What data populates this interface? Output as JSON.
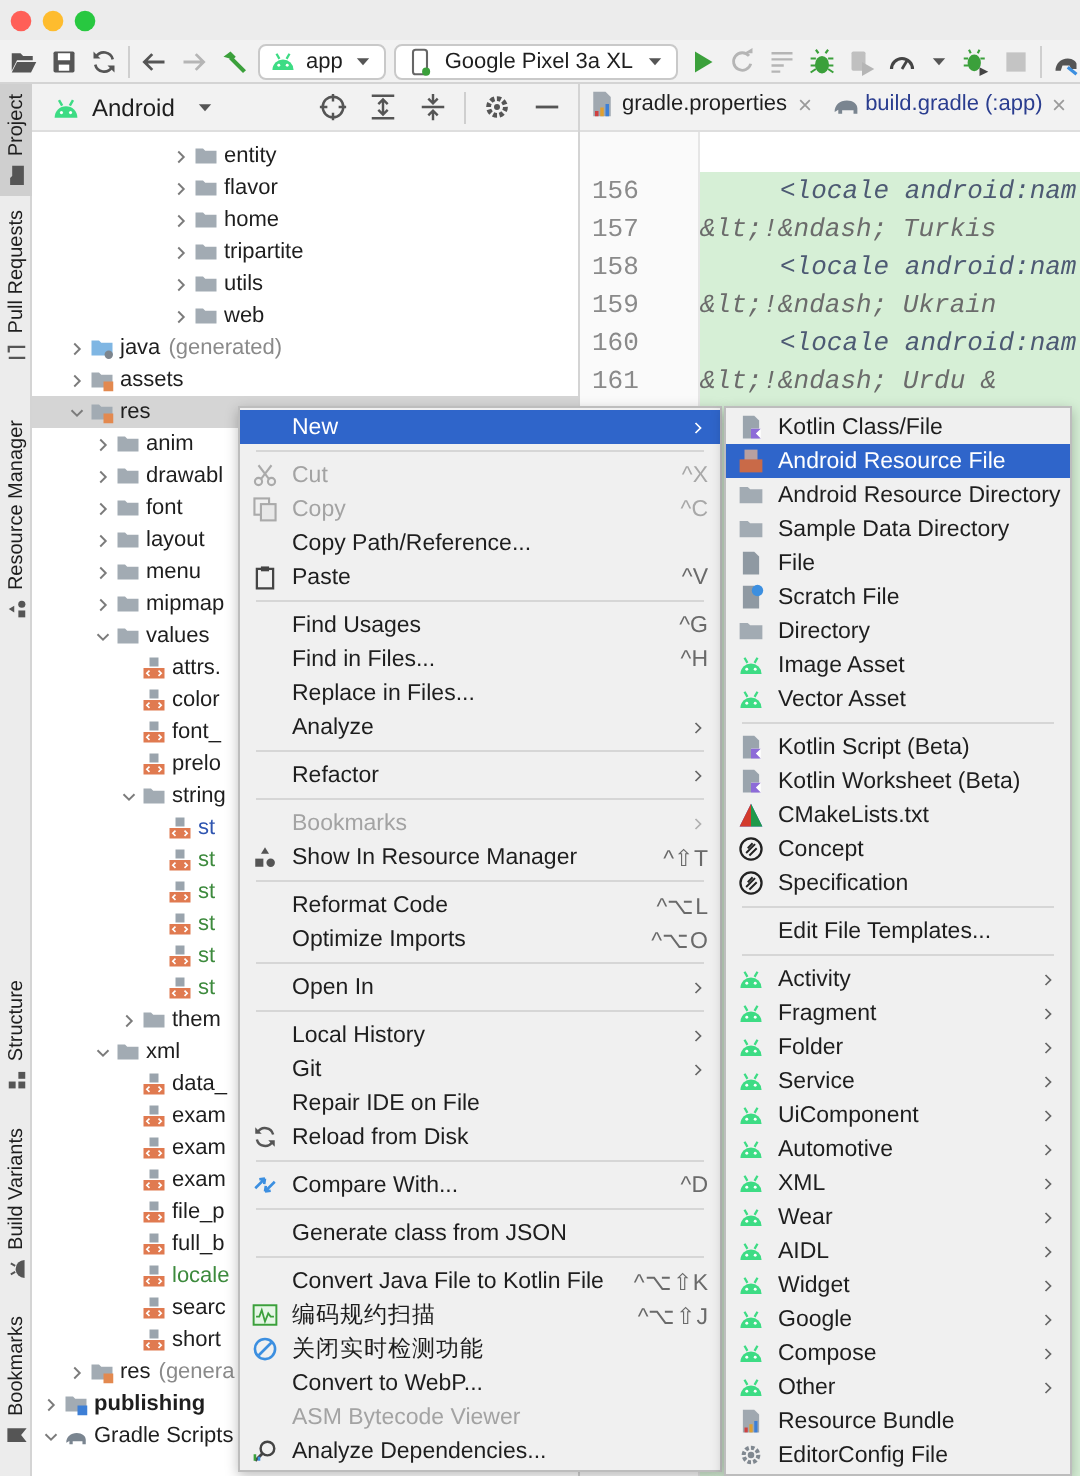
{
  "toolbar": {
    "module": "app",
    "device": "Google Pixel 3a XL"
  },
  "side_tabs": [
    {
      "label": "Project",
      "selected": true
    },
    {
      "label": "Pull Requests",
      "selected": false
    },
    {
      "label": "Resource Manager",
      "selected": false
    },
    {
      "label": "Structure",
      "selected": false
    },
    {
      "label": "Build Variants",
      "selected": false
    },
    {
      "label": "Bookmarks",
      "selected": false
    }
  ],
  "project_panel": {
    "view": "Android",
    "tree": [
      {
        "children": [
          {
            "children": [
              {
                "children": [
                  {
                    "children": [
                      {
                        "children": [
                          {
                            "label": "entity",
                            "kind": "folder",
                            "expanded": false,
                            "selected": false,
                            "color": "#1e1e1e"
                          },
                          {
                            "label": "flavor",
                            "kind": "folder",
                            "expanded": false,
                            "selected": false,
                            "color": "#1e1e1e"
                          },
                          {
                            "label": "home",
                            "kind": "folder",
                            "expanded": false,
                            "selected": false,
                            "color": "#1e1e1e"
                          },
                          {
                            "label": "tripartite",
                            "kind": "folder",
                            "expanded": false,
                            "selected": false,
                            "color": "#1e1e1e"
                          },
                          {
                            "label": "utils",
                            "kind": "folder",
                            "expanded": false,
                            "selected": false,
                            "color": "#1e1e1e"
                          },
                          {
                            "label": "web",
                            "kind": "folder",
                            "expanded": false,
                            "selected": false,
                            "color": "#1e1e1e"
                          }
                        ]
                      }
                    ]
                  }
                ]
              }
            ]
          },
          {
            "label": "java",
            "note": "(generated)",
            "kind": "generated",
            "expanded": false,
            "selected": false,
            "color": "#1e1e1e"
          },
          {
            "label": "assets",
            "kind": "resources",
            "expanded": false,
            "selected": false,
            "color": "#1e1e1e"
          },
          {
            "label": "res",
            "kind": "resources",
            "expanded": true,
            "selected": true,
            "color": "#1e1e1e",
            "children": [
              {
                "label": "anim",
                "kind": "folder",
                "expanded": false,
                "selected": false,
                "color": "#1e1e1e"
              },
              {
                "label": "drawabl",
                "kind": "folder",
                "expanded": false,
                "selected": false,
                "color": "#1e1e1e"
              },
              {
                "label": "font",
                "kind": "folder",
                "expanded": false,
                "selected": false,
                "color": "#1e1e1e"
              },
              {
                "label": "layout",
                "kind": "folder",
                "expanded": false,
                "selected": false,
                "color": "#1e1e1e"
              },
              {
                "label": "menu",
                "kind": "folder",
                "expanded": false,
                "selected": false,
                "color": "#1e1e1e"
              },
              {
                "label": "mipmap",
                "kind": "folder",
                "expanded": false,
                "selected": false,
                "color": "#1e1e1e"
              },
              {
                "label": "values",
                "kind": "folder",
                "expanded": true,
                "selected": false,
                "color": "#1e1e1e",
                "children": [
                  {
                    "label": "attrs.",
                    "kind": "xml",
                    "selected": false,
                    "color": "#1e1e1e"
                  },
                  {
                    "label": "color",
                    "kind": "xml",
                    "selected": false,
                    "color": "#1e1e1e"
                  },
                  {
                    "label": "font_",
                    "kind": "xml",
                    "selected": false,
                    "color": "#1e1e1e"
                  },
                  {
                    "label": "prelo",
                    "kind": "xml",
                    "selected": false,
                    "color": "#1e1e1e"
                  },
                  {
                    "label": "string",
                    "kind": "folder",
                    "expanded": true,
                    "selected": false,
                    "color": "#1e1e1e",
                    "children": [
                      {
                        "label": "st",
                        "kind": "xml",
                        "selected": false,
                        "color": "#2f55b0"
                      },
                      {
                        "label": "st",
                        "kind": "xml",
                        "selected": false,
                        "color": "#3d8a3d"
                      },
                      {
                        "label": "st",
                        "kind": "xml",
                        "selected": false,
                        "color": "#3d8a3d"
                      },
                      {
                        "label": "st",
                        "kind": "xml",
                        "selected": false,
                        "color": "#3d8a3d"
                      },
                      {
                        "label": "st",
                        "kind": "xml",
                        "selected": false,
                        "color": "#3d8a3d"
                      },
                      {
                        "label": "st",
                        "kind": "xml",
                        "selected": false,
                        "color": "#3d8a3d"
                      }
                    ]
                  },
                  {
                    "label": "them",
                    "kind": "folder",
                    "expanded": false,
                    "selected": false,
                    "color": "#1e1e1e"
                  }
                ]
              },
              {
                "label": "xml",
                "kind": "folder",
                "expanded": true,
                "selected": false,
                "color": "#1e1e1e",
                "children": [
                  {
                    "label": "data_",
                    "kind": "xml",
                    "selected": false,
                    "color": "#1e1e1e"
                  },
                  {
                    "label": "exam",
                    "kind": "xml",
                    "selected": false,
                    "color": "#1e1e1e"
                  },
                  {
                    "label": "exam",
                    "kind": "xml",
                    "selected": false,
                    "color": "#1e1e1e"
                  },
                  {
                    "label": "exam",
                    "kind": "xml",
                    "selected": false,
                    "color": "#1e1e1e"
                  },
                  {
                    "label": "file_p",
                    "kind": "xml",
                    "selected": false,
                    "color": "#1e1e1e"
                  },
                  {
                    "label": "full_b",
                    "kind": "xml",
                    "selected": false,
                    "color": "#1e1e1e"
                  },
                  {
                    "label": "locale",
                    "kind": "xml",
                    "selected": false,
                    "color": "#3d8a3d"
                  },
                  {
                    "label": "searc",
                    "kind": "xml",
                    "selected": false,
                    "color": "#1e1e1e"
                  },
                  {
                    "label": "short",
                    "kind": "xml",
                    "selected": false,
                    "color": "#1e1e1e"
                  }
                ]
              }
            ]
          },
          {
            "label": "res",
            "note": "(genera",
            "kind": "resources",
            "expanded": false,
            "selected": false,
            "color": "#1e1e1e"
          }
        ]
      },
      {
        "label": "publishing",
        "kind": "module",
        "expanded": false,
        "selected": false,
        "color": "#1e1e1e"
      },
      {
        "label": "Gradle Scripts",
        "kind": "gradle",
        "expanded": true,
        "selected": false,
        "color": "#1e1e1e"
      }
    ]
  },
  "editor": {
    "tabs": [
      {
        "label": "gradle.properties",
        "selected": false
      },
      {
        "label": "build.gradle (:app)",
        "selected": false
      }
    ],
    "lines": [
      {
        "number": "156",
        "kind": "tag",
        "text": "<locale android:nam"
      },
      {
        "number": "157",
        "kind": "comment",
        "text": "&lt;!&ndash; Turkis"
      },
      {
        "number": "158",
        "kind": "tag",
        "text": "<locale android:nam"
      },
      {
        "number": "159",
        "kind": "comment",
        "text": "&lt;!&ndash; Ukrain"
      },
      {
        "number": "160",
        "kind": "tag",
        "text": "<locale android:nam"
      },
      {
        "number": "161",
        "kind": "comment",
        "text": "&lt;!&ndash; Urdu &"
      }
    ]
  },
  "context_menu": {
    "items": [
      {
        "kind": "item",
        "label": "New",
        "has_submenu": true,
        "selected": true,
        "disabled": false
      },
      {
        "kind": "separator"
      },
      {
        "kind": "item",
        "label": "Cut",
        "shortcut": "^X",
        "selected": false,
        "disabled": true
      },
      {
        "kind": "item",
        "label": "Copy",
        "shortcut": "^C",
        "selected": false,
        "disabled": true
      },
      {
        "kind": "item",
        "label": "Copy Path/Reference...",
        "selected": false,
        "disabled": false
      },
      {
        "kind": "item",
        "label": "Paste",
        "shortcut": "^V",
        "selected": false,
        "disabled": false
      },
      {
        "kind": "separator"
      },
      {
        "kind": "item",
        "label": "Find Usages",
        "shortcut": "^G",
        "selected": false,
        "disabled": false
      },
      {
        "kind": "item",
        "label": "Find in Files...",
        "shortcut": "^H",
        "selected": false,
        "disabled": false
      },
      {
        "kind": "item",
        "label": "Replace in Files...",
        "selected": false,
        "disabled": false
      },
      {
        "kind": "item",
        "label": "Analyze",
        "has_submenu": true,
        "selected": false,
        "disabled": false
      },
      {
        "kind": "separator"
      },
      {
        "kind": "item",
        "label": "Refactor",
        "has_submenu": true,
        "selected": false,
        "disabled": false
      },
      {
        "kind": "separator"
      },
      {
        "kind": "item",
        "label": "Bookmarks",
        "has_submenu": true,
        "selected": false,
        "disabled": true
      },
      {
        "kind": "item",
        "label": "Show In Resource Manager",
        "shortcut": "^⇧T",
        "selected": false,
        "disabled": false
      },
      {
        "kind": "separator"
      },
      {
        "kind": "item",
        "label": "Reformat Code",
        "shortcut": "^⌥L",
        "selected": false,
        "disabled": false
      },
      {
        "kind": "item",
        "label": "Optimize Imports",
        "shortcut": "^⌥O",
        "selected": false,
        "disabled": false
      },
      {
        "kind": "separator"
      },
      {
        "kind": "item",
        "label": "Open In",
        "has_submenu": true,
        "selected": false,
        "disabled": false
      },
      {
        "kind": "separator"
      },
      {
        "kind": "item",
        "label": "Local History",
        "has_submenu": true,
        "selected": false,
        "disabled": false
      },
      {
        "kind": "item",
        "label": "Git",
        "has_submenu": true,
        "selected": false,
        "disabled": false
      },
      {
        "kind": "item",
        "label": "Repair IDE on File",
        "selected": false,
        "disabled": false
      },
      {
        "kind": "item",
        "label": "Reload from Disk",
        "selected": false,
        "disabled": false
      },
      {
        "kind": "separator"
      },
      {
        "kind": "item",
        "label": "Compare With...",
        "shortcut": "^D",
        "selected": false,
        "disabled": false
      },
      {
        "kind": "separator"
      },
      {
        "kind": "item",
        "label": "Generate class from JSON",
        "selected": false,
        "disabled": false
      },
      {
        "kind": "separator"
      },
      {
        "kind": "item",
        "label": "Convert Java File to Kotlin File",
        "shortcut": "^⌥⇧K",
        "selected": false,
        "disabled": false
      },
      {
        "kind": "item",
        "label": "编码规约扫描",
        "shortcut": "^⌥⇧J",
        "selected": false,
        "disabled": false
      },
      {
        "kind": "item",
        "label": "关闭实时检测功能",
        "selected": false,
        "disabled": false
      },
      {
        "kind": "item",
        "label": "Convert to WebP...",
        "selected": false,
        "disabled": false
      },
      {
        "kind": "item",
        "label": "ASM Bytecode Viewer",
        "selected": false,
        "disabled": true
      },
      {
        "kind": "item",
        "label": "Analyze Dependencies...",
        "selected": false,
        "disabled": false
      }
    ]
  },
  "new_submenu": {
    "items": [
      {
        "kind": "item",
        "label": "Kotlin Class/File",
        "selected": false
      },
      {
        "kind": "item",
        "label": "Android Resource File",
        "selected": true
      },
      {
        "kind": "item",
        "label": "Android Resource Directory",
        "selected": false
      },
      {
        "kind": "item",
        "label": "Sample Data Directory",
        "selected": false
      },
      {
        "kind": "item",
        "label": "File",
        "selected": false
      },
      {
        "kind": "item",
        "label": "Scratch File",
        "selected": false
      },
      {
        "kind": "item",
        "label": "Directory",
        "selected": false
      },
      {
        "kind": "item",
        "label": "Image Asset",
        "selected": false
      },
      {
        "kind": "item",
        "label": "Vector Asset",
        "selected": false
      },
      {
        "kind": "separator"
      },
      {
        "kind": "item",
        "label": "Kotlin Script (Beta)",
        "selected": false
      },
      {
        "kind": "item",
        "label": "Kotlin Worksheet (Beta)",
        "selected": false
      },
      {
        "kind": "item",
        "label": "CMakeLists.txt",
        "selected": false
      },
      {
        "kind": "item",
        "label": "Concept",
        "selected": false
      },
      {
        "kind": "item",
        "label": "Specification",
        "selected": false
      },
      {
        "kind": "separator"
      },
      {
        "kind": "item",
        "label": "Edit File Templates...",
        "selected": false
      },
      {
        "kind": "separator"
      },
      {
        "kind": "item",
        "label": "Activity",
        "has_submenu": true,
        "selected": false
      },
      {
        "kind": "item",
        "label": "Fragment",
        "has_submenu": true,
        "selected": false
      },
      {
        "kind": "item",
        "label": "Folder",
        "has_submenu": true,
        "selected": false
      },
      {
        "kind": "item",
        "label": "Service",
        "has_submenu": true,
        "selected": false
      },
      {
        "kind": "item",
        "label": "UiComponent",
        "has_submenu": true,
        "selected": false
      },
      {
        "kind": "item",
        "label": "Automotive",
        "has_submenu": true,
        "selected": false
      },
      {
        "kind": "item",
        "label": "XML",
        "has_submenu": true,
        "selected": false
      },
      {
        "kind": "item",
        "label": "Wear",
        "has_submenu": true,
        "selected": false
      },
      {
        "kind": "item",
        "label": "AIDL",
        "has_submenu": true,
        "selected": false
      },
      {
        "kind": "item",
        "label": "Widget",
        "has_submenu": true,
        "selected": false
      },
      {
        "kind": "item",
        "label": "Google",
        "has_submenu": true,
        "selected": false
      },
      {
        "kind": "item",
        "label": "Compose",
        "has_submenu": true,
        "selected": false
      },
      {
        "kind": "item",
        "label": "Other",
        "has_submenu": true,
        "selected": false
      },
      {
        "kind": "item",
        "label": "Resource Bundle",
        "selected": false
      },
      {
        "kind": "item",
        "label": "EditorConfig File",
        "selected": false
      }
    ]
  }
}
